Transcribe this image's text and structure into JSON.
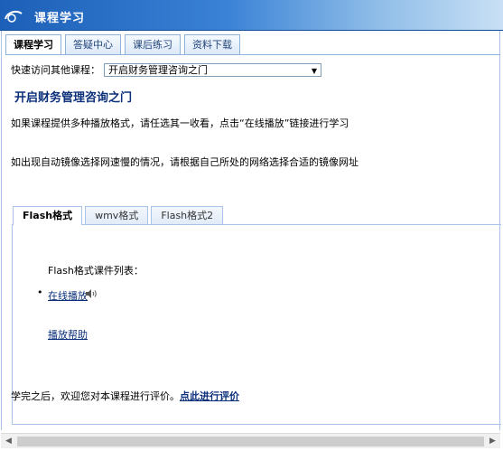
{
  "header": {
    "title": "课程学习"
  },
  "main_tabs": [
    {
      "label": "课程学习",
      "active": true
    },
    {
      "label": "答疑中心",
      "active": false
    },
    {
      "label": "课后练习",
      "active": false
    },
    {
      "label": "资料下载",
      "active": false
    }
  ],
  "quick_access": {
    "label": "快速访问其他课程：",
    "selected": "开启财务管理咨询之门",
    "arrow": "▼"
  },
  "course": {
    "title": "开启财务管理咨询之门",
    "instruction1": "如果课程提供多种播放格式，请任选其一收看，点击“在线播放”链接进行学习",
    "instruction2": "如出现自动镜像选择网速慢的情况，请根据自己所处的网络选择合适的镜像网址"
  },
  "format_tabs": [
    {
      "label": "Flash格式",
      "active": true
    },
    {
      "label": "wmv格式",
      "active": false
    },
    {
      "label": "Flash格式2",
      "active": false
    }
  ],
  "courseware": {
    "list_title": "Flash格式课件列表：",
    "bullet": "•",
    "play_link": "在线播放",
    "help_link": "播放帮助"
  },
  "evaluation": {
    "text": "学完之后，欢迎您对本课程进行评价。",
    "link": "点此进行评价"
  },
  "scrollbar": {
    "left_arrow": "◀",
    "right_arrow": "▶"
  },
  "colors": {
    "header_blue": "#1c5fb8",
    "link_blue": "#0b2f7a",
    "tab_border": "#8fb2dc"
  }
}
